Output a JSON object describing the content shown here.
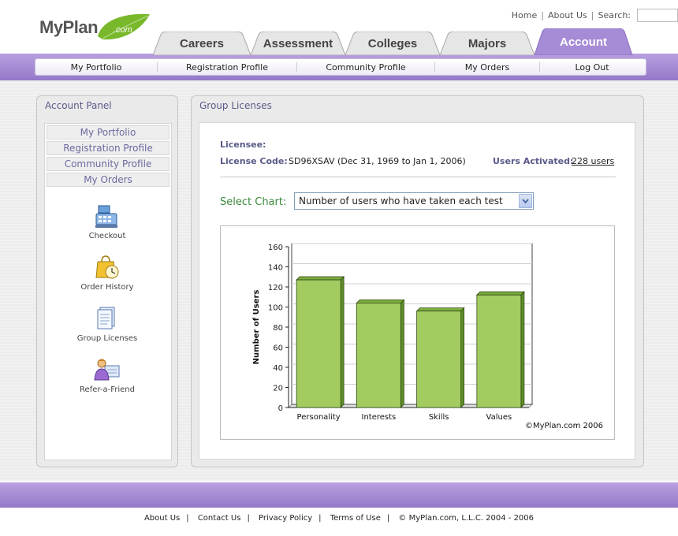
{
  "logo": {
    "text": "MyPlan",
    "suffix": ".com"
  },
  "topnav": {
    "home": "Home",
    "about": "About Us",
    "search_label": "Search:"
  },
  "tabs": [
    {
      "label": "Careers",
      "active": false
    },
    {
      "label": "Assessment",
      "active": false
    },
    {
      "label": "Colleges",
      "active": false
    },
    {
      "label": "Majors",
      "active": false
    },
    {
      "label": "Account",
      "active": true
    }
  ],
  "subnav": [
    "My Portfolio",
    "Registration Profile",
    "Community Profile",
    "My Orders",
    "Log Out"
  ],
  "account_panel": {
    "title": "Account Panel",
    "links": [
      "My Portfolio",
      "Registration Profile",
      "Community Profile",
      "My Orders"
    ],
    "icons": [
      {
        "label": "Checkout",
        "icon": "cash-register-icon"
      },
      {
        "label": "Order History",
        "icon": "shopping-bag-clock-icon"
      },
      {
        "label": "Group Licenses",
        "icon": "document-icon"
      },
      {
        "label": "Refer-a-Friend",
        "icon": "person-card-icon"
      }
    ]
  },
  "main": {
    "title": "Group Licenses",
    "licensee_label": "Licensee:",
    "license_code_label": "License Code:",
    "license_code_value": "SD96XSAV (Dec 31, 1969 to Jan 1, 2006)",
    "users_activated_label": "Users Activated:",
    "users_activated_value": "228 users",
    "select_chart_label": "Select Chart:",
    "select_chart_value": "Number of users who have taken each test"
  },
  "chart_data": {
    "type": "bar",
    "categories": [
      "Personality",
      "Interests",
      "Skills",
      "Values"
    ],
    "values": [
      127,
      104,
      96,
      112
    ],
    "ylabel": "Number of Users",
    "xlabel": "",
    "ylim": [
      0,
      160
    ],
    "yticks": [
      0,
      20,
      40,
      60,
      80,
      100,
      120,
      140,
      160
    ],
    "grid": true,
    "bar_color": "#a2cc60",
    "copyright": "©MyPlan.com 2006"
  },
  "colors": {
    "accent_purple": "#a68bd6",
    "label_blue": "#5a5a8a",
    "select_green": "#3a8a3a"
  },
  "footer": [
    "About Us",
    "Contact Us",
    "Privacy Policy",
    "Terms of Use",
    "© MyPlan.com, L.L.C. 2004 - 2006"
  ]
}
